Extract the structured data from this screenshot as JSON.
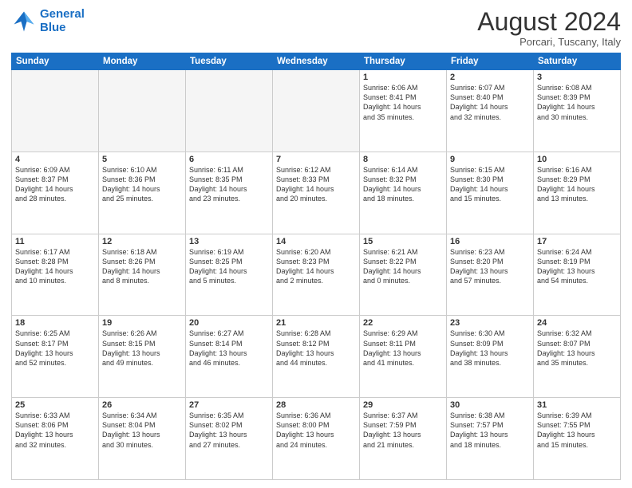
{
  "header": {
    "logo_line1": "General",
    "logo_line2": "Blue",
    "month": "August 2024",
    "location": "Porcari, Tuscany, Italy"
  },
  "days_of_week": [
    "Sunday",
    "Monday",
    "Tuesday",
    "Wednesday",
    "Thursday",
    "Friday",
    "Saturday"
  ],
  "weeks": [
    [
      {
        "day": "",
        "info": ""
      },
      {
        "day": "",
        "info": ""
      },
      {
        "day": "",
        "info": ""
      },
      {
        "day": "",
        "info": ""
      },
      {
        "day": "1",
        "info": "Sunrise: 6:06 AM\nSunset: 8:41 PM\nDaylight: 14 hours\nand 35 minutes."
      },
      {
        "day": "2",
        "info": "Sunrise: 6:07 AM\nSunset: 8:40 PM\nDaylight: 14 hours\nand 32 minutes."
      },
      {
        "day": "3",
        "info": "Sunrise: 6:08 AM\nSunset: 8:39 PM\nDaylight: 14 hours\nand 30 minutes."
      }
    ],
    [
      {
        "day": "4",
        "info": "Sunrise: 6:09 AM\nSunset: 8:37 PM\nDaylight: 14 hours\nand 28 minutes."
      },
      {
        "day": "5",
        "info": "Sunrise: 6:10 AM\nSunset: 8:36 PM\nDaylight: 14 hours\nand 25 minutes."
      },
      {
        "day": "6",
        "info": "Sunrise: 6:11 AM\nSunset: 8:35 PM\nDaylight: 14 hours\nand 23 minutes."
      },
      {
        "day": "7",
        "info": "Sunrise: 6:12 AM\nSunset: 8:33 PM\nDaylight: 14 hours\nand 20 minutes."
      },
      {
        "day": "8",
        "info": "Sunrise: 6:14 AM\nSunset: 8:32 PM\nDaylight: 14 hours\nand 18 minutes."
      },
      {
        "day": "9",
        "info": "Sunrise: 6:15 AM\nSunset: 8:30 PM\nDaylight: 14 hours\nand 15 minutes."
      },
      {
        "day": "10",
        "info": "Sunrise: 6:16 AM\nSunset: 8:29 PM\nDaylight: 14 hours\nand 13 minutes."
      }
    ],
    [
      {
        "day": "11",
        "info": "Sunrise: 6:17 AM\nSunset: 8:28 PM\nDaylight: 14 hours\nand 10 minutes."
      },
      {
        "day": "12",
        "info": "Sunrise: 6:18 AM\nSunset: 8:26 PM\nDaylight: 14 hours\nand 8 minutes."
      },
      {
        "day": "13",
        "info": "Sunrise: 6:19 AM\nSunset: 8:25 PM\nDaylight: 14 hours\nand 5 minutes."
      },
      {
        "day": "14",
        "info": "Sunrise: 6:20 AM\nSunset: 8:23 PM\nDaylight: 14 hours\nand 2 minutes."
      },
      {
        "day": "15",
        "info": "Sunrise: 6:21 AM\nSunset: 8:22 PM\nDaylight: 14 hours\nand 0 minutes."
      },
      {
        "day": "16",
        "info": "Sunrise: 6:23 AM\nSunset: 8:20 PM\nDaylight: 13 hours\nand 57 minutes."
      },
      {
        "day": "17",
        "info": "Sunrise: 6:24 AM\nSunset: 8:19 PM\nDaylight: 13 hours\nand 54 minutes."
      }
    ],
    [
      {
        "day": "18",
        "info": "Sunrise: 6:25 AM\nSunset: 8:17 PM\nDaylight: 13 hours\nand 52 minutes."
      },
      {
        "day": "19",
        "info": "Sunrise: 6:26 AM\nSunset: 8:15 PM\nDaylight: 13 hours\nand 49 minutes."
      },
      {
        "day": "20",
        "info": "Sunrise: 6:27 AM\nSunset: 8:14 PM\nDaylight: 13 hours\nand 46 minutes."
      },
      {
        "day": "21",
        "info": "Sunrise: 6:28 AM\nSunset: 8:12 PM\nDaylight: 13 hours\nand 44 minutes."
      },
      {
        "day": "22",
        "info": "Sunrise: 6:29 AM\nSunset: 8:11 PM\nDaylight: 13 hours\nand 41 minutes."
      },
      {
        "day": "23",
        "info": "Sunrise: 6:30 AM\nSunset: 8:09 PM\nDaylight: 13 hours\nand 38 minutes."
      },
      {
        "day": "24",
        "info": "Sunrise: 6:32 AM\nSunset: 8:07 PM\nDaylight: 13 hours\nand 35 minutes."
      }
    ],
    [
      {
        "day": "25",
        "info": "Sunrise: 6:33 AM\nSunset: 8:06 PM\nDaylight: 13 hours\nand 32 minutes."
      },
      {
        "day": "26",
        "info": "Sunrise: 6:34 AM\nSunset: 8:04 PM\nDaylight: 13 hours\nand 30 minutes."
      },
      {
        "day": "27",
        "info": "Sunrise: 6:35 AM\nSunset: 8:02 PM\nDaylight: 13 hours\nand 27 minutes."
      },
      {
        "day": "28",
        "info": "Sunrise: 6:36 AM\nSunset: 8:00 PM\nDaylight: 13 hours\nand 24 minutes."
      },
      {
        "day": "29",
        "info": "Sunrise: 6:37 AM\nSunset: 7:59 PM\nDaylight: 13 hours\nand 21 minutes."
      },
      {
        "day": "30",
        "info": "Sunrise: 6:38 AM\nSunset: 7:57 PM\nDaylight: 13 hours\nand 18 minutes."
      },
      {
        "day": "31",
        "info": "Sunrise: 6:39 AM\nSunset: 7:55 PM\nDaylight: 13 hours\nand 15 minutes."
      }
    ]
  ]
}
